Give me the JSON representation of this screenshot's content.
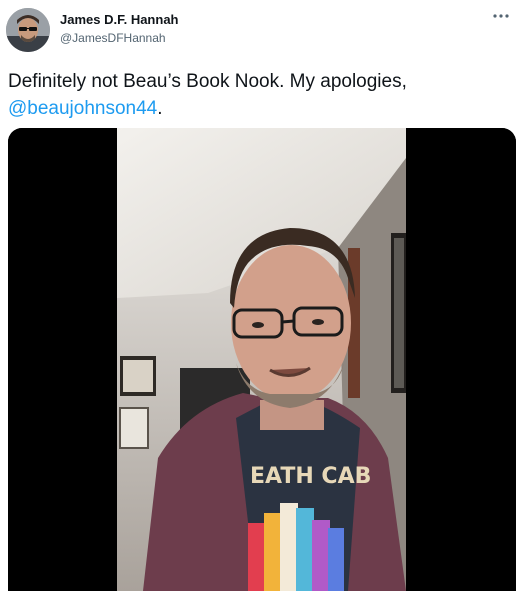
{
  "author": {
    "name": "James D.F. Hannah",
    "handle": "@JamesDFHannah"
  },
  "tweet": {
    "text_before": "Definitely not Beau’s Book Nook. My apologies,",
    "mention": "@beaujohnson44",
    "text_after": "."
  },
  "media": {
    "type": "video",
    "shirt_text": "EATH CAB"
  },
  "icons": {
    "more": "more-icon"
  },
  "colors": {
    "link": "#1d9bf0",
    "secondary_text": "#536471",
    "primary_text": "#0f1419"
  }
}
